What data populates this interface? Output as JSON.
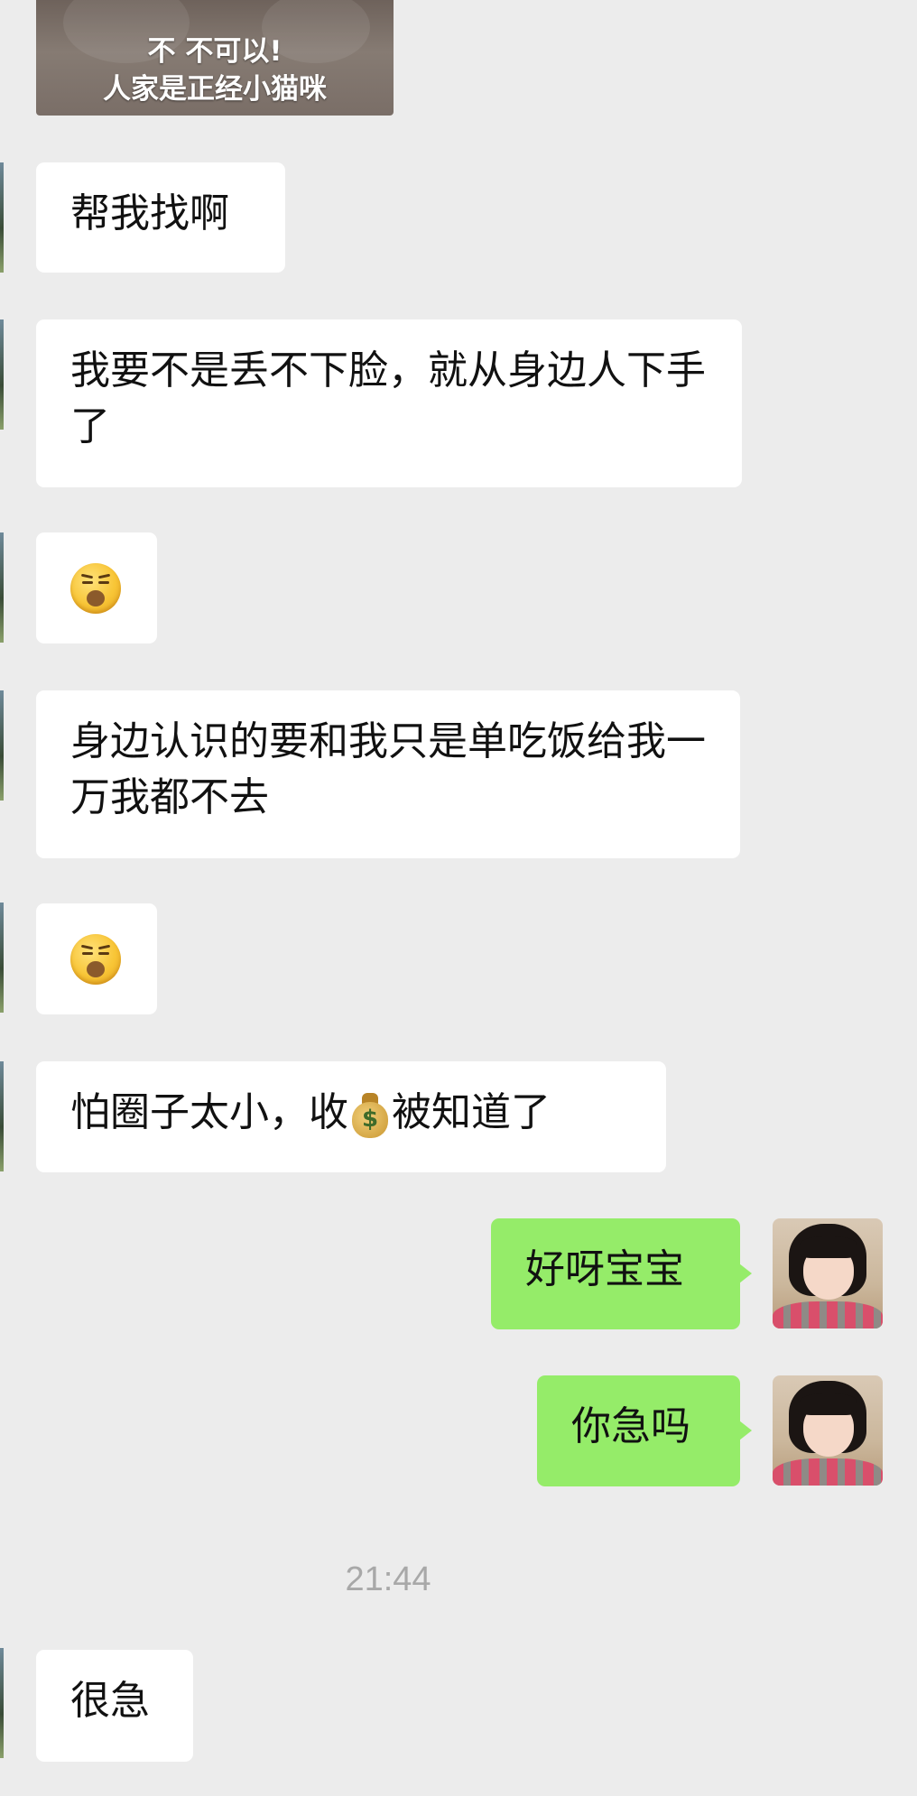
{
  "sticker": {
    "line1": "不 不可以!",
    "line2": "人家是正经小猫咪"
  },
  "messages": [
    {
      "text": "帮我找啊"
    },
    {
      "text": "我要不是丢不下脸，就从身边人下手了"
    },
    {
      "emoji": "unamused-pouting-face-emoji"
    },
    {
      "text": "身边认识的要和我只是单吃饭给我一万我都不去"
    },
    {
      "emoji": "unamused-pouting-face-emoji"
    },
    {
      "text_before": "怕圈子太小，收",
      "icon": "money-bag-emoji",
      "icon_glyph": "$",
      "text_after": "被知道了"
    },
    {
      "text": "好呀宝宝",
      "self": true
    },
    {
      "text": "你急吗",
      "self": true
    },
    {
      "text": "很急"
    }
  ],
  "timestamp": "21:44",
  "colors": {
    "background": "#ececec",
    "incoming_bubble": "#ffffff",
    "outgoing_bubble": "#95ec69",
    "timestamp": "#a8a8a8"
  }
}
